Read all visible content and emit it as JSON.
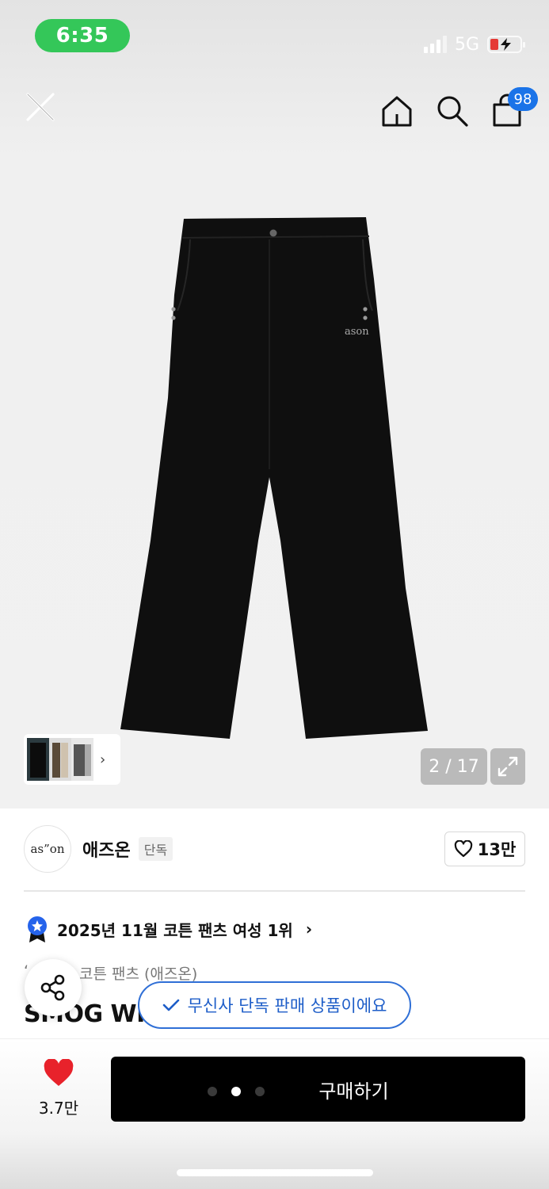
{
  "status_bar": {
    "time": "6:35",
    "network": "5G",
    "battery_icon": "battery-charging-icon"
  },
  "top_nav": {
    "close_icon": "close-icon",
    "home_icon": "home-icon",
    "search_icon": "search-icon",
    "cart_icon": "shopping-bag-icon",
    "cart_badge": "98"
  },
  "gallery": {
    "logo_text": "ason",
    "counter": "2 / 17",
    "thumb_chevron": "›",
    "expand_icon": "expand-icon"
  },
  "brand": {
    "logo_text": "as”on",
    "name": "애즈온",
    "tag": "단독",
    "like_count": "13만"
  },
  "ranking": {
    "text": "2025년 11월 코튼 팬츠 여성 1위",
    "chevron": "›"
  },
  "category": {
    "prefix": "‘",
    "text": "코튼 팬츠 (애즈온)"
  },
  "product": {
    "title": "SMOG WID"
  },
  "toast": {
    "text": "무신사 단독 판매 상품이에요"
  },
  "bottom_bar": {
    "wish_count": "3.7만",
    "buy_label": "구매하기"
  },
  "colors": {
    "accent_blue": "#1d5dc8",
    "heart_red": "#e8222b",
    "status_green": "#34c759"
  }
}
